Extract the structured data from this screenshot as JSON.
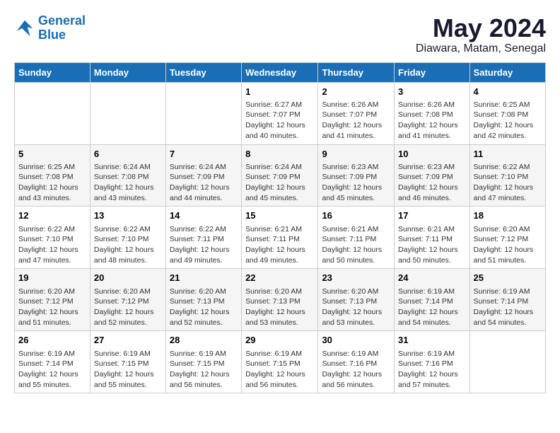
{
  "header": {
    "logo_line1": "General",
    "logo_line2": "Blue",
    "title": "May 2024",
    "subtitle": "Diawara, Matam, Senegal"
  },
  "weekdays": [
    "Sunday",
    "Monday",
    "Tuesday",
    "Wednesday",
    "Thursday",
    "Friday",
    "Saturday"
  ],
  "weeks": [
    [
      {
        "day": "",
        "info": ""
      },
      {
        "day": "",
        "info": ""
      },
      {
        "day": "",
        "info": ""
      },
      {
        "day": "1",
        "info": "Sunrise: 6:27 AM\nSunset: 7:07 PM\nDaylight: 12 hours\nand 40 minutes."
      },
      {
        "day": "2",
        "info": "Sunrise: 6:26 AM\nSunset: 7:07 PM\nDaylight: 12 hours\nand 41 minutes."
      },
      {
        "day": "3",
        "info": "Sunrise: 6:26 AM\nSunset: 7:08 PM\nDaylight: 12 hours\nand 41 minutes."
      },
      {
        "day": "4",
        "info": "Sunrise: 6:25 AM\nSunset: 7:08 PM\nDaylight: 12 hours\nand 42 minutes."
      }
    ],
    [
      {
        "day": "5",
        "info": "Sunrise: 6:25 AM\nSunset: 7:08 PM\nDaylight: 12 hours\nand 43 minutes."
      },
      {
        "day": "6",
        "info": "Sunrise: 6:24 AM\nSunset: 7:08 PM\nDaylight: 12 hours\nand 43 minutes."
      },
      {
        "day": "7",
        "info": "Sunrise: 6:24 AM\nSunset: 7:09 PM\nDaylight: 12 hours\nand 44 minutes."
      },
      {
        "day": "8",
        "info": "Sunrise: 6:24 AM\nSunset: 7:09 PM\nDaylight: 12 hours\nand 45 minutes."
      },
      {
        "day": "9",
        "info": "Sunrise: 6:23 AM\nSunset: 7:09 PM\nDaylight: 12 hours\nand 45 minutes."
      },
      {
        "day": "10",
        "info": "Sunrise: 6:23 AM\nSunset: 7:09 PM\nDaylight: 12 hours\nand 46 minutes."
      },
      {
        "day": "11",
        "info": "Sunrise: 6:22 AM\nSunset: 7:10 PM\nDaylight: 12 hours\nand 47 minutes."
      }
    ],
    [
      {
        "day": "12",
        "info": "Sunrise: 6:22 AM\nSunset: 7:10 PM\nDaylight: 12 hours\nand 47 minutes."
      },
      {
        "day": "13",
        "info": "Sunrise: 6:22 AM\nSunset: 7:10 PM\nDaylight: 12 hours\nand 48 minutes."
      },
      {
        "day": "14",
        "info": "Sunrise: 6:22 AM\nSunset: 7:11 PM\nDaylight: 12 hours\nand 49 minutes."
      },
      {
        "day": "15",
        "info": "Sunrise: 6:21 AM\nSunset: 7:11 PM\nDaylight: 12 hours\nand 49 minutes."
      },
      {
        "day": "16",
        "info": "Sunrise: 6:21 AM\nSunset: 7:11 PM\nDaylight: 12 hours\nand 50 minutes."
      },
      {
        "day": "17",
        "info": "Sunrise: 6:21 AM\nSunset: 7:11 PM\nDaylight: 12 hours\nand 50 minutes."
      },
      {
        "day": "18",
        "info": "Sunrise: 6:20 AM\nSunset: 7:12 PM\nDaylight: 12 hours\nand 51 minutes."
      }
    ],
    [
      {
        "day": "19",
        "info": "Sunrise: 6:20 AM\nSunset: 7:12 PM\nDaylight: 12 hours\nand 51 minutes."
      },
      {
        "day": "20",
        "info": "Sunrise: 6:20 AM\nSunset: 7:12 PM\nDaylight: 12 hours\nand 52 minutes."
      },
      {
        "day": "21",
        "info": "Sunrise: 6:20 AM\nSunset: 7:13 PM\nDaylight: 12 hours\nand 52 minutes."
      },
      {
        "day": "22",
        "info": "Sunrise: 6:20 AM\nSunset: 7:13 PM\nDaylight: 12 hours\nand 53 minutes."
      },
      {
        "day": "23",
        "info": "Sunrise: 6:20 AM\nSunset: 7:13 PM\nDaylight: 12 hours\nand 53 minutes."
      },
      {
        "day": "24",
        "info": "Sunrise: 6:19 AM\nSunset: 7:14 PM\nDaylight: 12 hours\nand 54 minutes."
      },
      {
        "day": "25",
        "info": "Sunrise: 6:19 AM\nSunset: 7:14 PM\nDaylight: 12 hours\nand 54 minutes."
      }
    ],
    [
      {
        "day": "26",
        "info": "Sunrise: 6:19 AM\nSunset: 7:14 PM\nDaylight: 12 hours\nand 55 minutes."
      },
      {
        "day": "27",
        "info": "Sunrise: 6:19 AM\nSunset: 7:15 PM\nDaylight: 12 hours\nand 55 minutes."
      },
      {
        "day": "28",
        "info": "Sunrise: 6:19 AM\nSunset: 7:15 PM\nDaylight: 12 hours\nand 56 minutes."
      },
      {
        "day": "29",
        "info": "Sunrise: 6:19 AM\nSunset: 7:15 PM\nDaylight: 12 hours\nand 56 minutes."
      },
      {
        "day": "30",
        "info": "Sunrise: 6:19 AM\nSunset: 7:16 PM\nDaylight: 12 hours\nand 56 minutes."
      },
      {
        "day": "31",
        "info": "Sunrise: 6:19 AM\nSunset: 7:16 PM\nDaylight: 12 hours\nand 57 minutes."
      },
      {
        "day": "",
        "info": ""
      }
    ]
  ]
}
